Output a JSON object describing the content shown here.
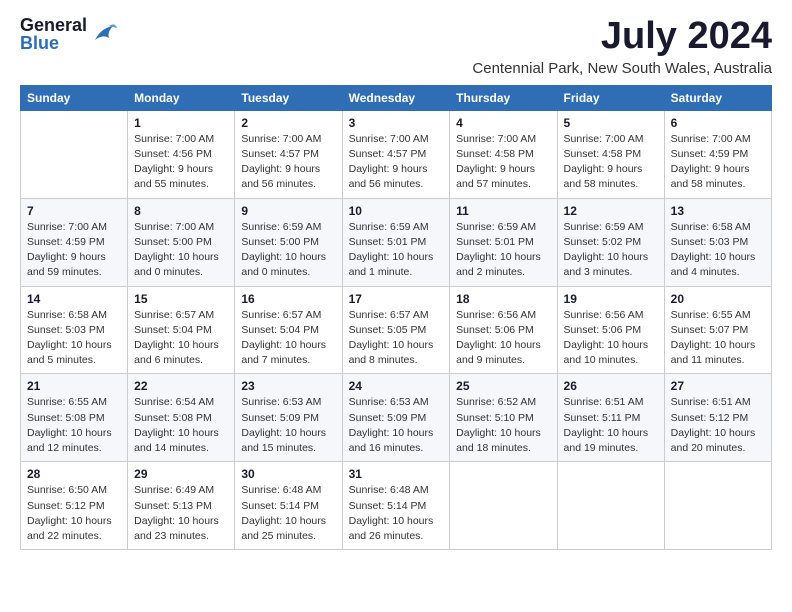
{
  "logo": {
    "general": "General",
    "blue": "Blue"
  },
  "title": "July 2024",
  "subtitle": "Centennial Park, New South Wales, Australia",
  "weekdays": [
    "Sunday",
    "Monday",
    "Tuesday",
    "Wednesday",
    "Thursday",
    "Friday",
    "Saturday"
  ],
  "weeks": [
    [
      {
        "day": "",
        "sunrise": "",
        "sunset": "",
        "daylight": ""
      },
      {
        "day": "1",
        "sunrise": "Sunrise: 7:00 AM",
        "sunset": "Sunset: 4:56 PM",
        "daylight": "Daylight: 9 hours and 55 minutes."
      },
      {
        "day": "2",
        "sunrise": "Sunrise: 7:00 AM",
        "sunset": "Sunset: 4:57 PM",
        "daylight": "Daylight: 9 hours and 56 minutes."
      },
      {
        "day": "3",
        "sunrise": "Sunrise: 7:00 AM",
        "sunset": "Sunset: 4:57 PM",
        "daylight": "Daylight: 9 hours and 56 minutes."
      },
      {
        "day": "4",
        "sunrise": "Sunrise: 7:00 AM",
        "sunset": "Sunset: 4:58 PM",
        "daylight": "Daylight: 9 hours and 57 minutes."
      },
      {
        "day": "5",
        "sunrise": "Sunrise: 7:00 AM",
        "sunset": "Sunset: 4:58 PM",
        "daylight": "Daylight: 9 hours and 58 minutes."
      },
      {
        "day": "6",
        "sunrise": "Sunrise: 7:00 AM",
        "sunset": "Sunset: 4:59 PM",
        "daylight": "Daylight: 9 hours and 58 minutes."
      }
    ],
    [
      {
        "day": "7",
        "sunrise": "Sunrise: 7:00 AM",
        "sunset": "Sunset: 4:59 PM",
        "daylight": "Daylight: 9 hours and 59 minutes."
      },
      {
        "day": "8",
        "sunrise": "Sunrise: 7:00 AM",
        "sunset": "Sunset: 5:00 PM",
        "daylight": "Daylight: 10 hours and 0 minutes."
      },
      {
        "day": "9",
        "sunrise": "Sunrise: 6:59 AM",
        "sunset": "Sunset: 5:00 PM",
        "daylight": "Daylight: 10 hours and 0 minutes."
      },
      {
        "day": "10",
        "sunrise": "Sunrise: 6:59 AM",
        "sunset": "Sunset: 5:01 PM",
        "daylight": "Daylight: 10 hours and 1 minute."
      },
      {
        "day": "11",
        "sunrise": "Sunrise: 6:59 AM",
        "sunset": "Sunset: 5:01 PM",
        "daylight": "Daylight: 10 hours and 2 minutes."
      },
      {
        "day": "12",
        "sunrise": "Sunrise: 6:59 AM",
        "sunset": "Sunset: 5:02 PM",
        "daylight": "Daylight: 10 hours and 3 minutes."
      },
      {
        "day": "13",
        "sunrise": "Sunrise: 6:58 AM",
        "sunset": "Sunset: 5:03 PM",
        "daylight": "Daylight: 10 hours and 4 minutes."
      }
    ],
    [
      {
        "day": "14",
        "sunrise": "Sunrise: 6:58 AM",
        "sunset": "Sunset: 5:03 PM",
        "daylight": "Daylight: 10 hours and 5 minutes."
      },
      {
        "day": "15",
        "sunrise": "Sunrise: 6:57 AM",
        "sunset": "Sunset: 5:04 PM",
        "daylight": "Daylight: 10 hours and 6 minutes."
      },
      {
        "day": "16",
        "sunrise": "Sunrise: 6:57 AM",
        "sunset": "Sunset: 5:04 PM",
        "daylight": "Daylight: 10 hours and 7 minutes."
      },
      {
        "day": "17",
        "sunrise": "Sunrise: 6:57 AM",
        "sunset": "Sunset: 5:05 PM",
        "daylight": "Daylight: 10 hours and 8 minutes."
      },
      {
        "day": "18",
        "sunrise": "Sunrise: 6:56 AM",
        "sunset": "Sunset: 5:06 PM",
        "daylight": "Daylight: 10 hours and 9 minutes."
      },
      {
        "day": "19",
        "sunrise": "Sunrise: 6:56 AM",
        "sunset": "Sunset: 5:06 PM",
        "daylight": "Daylight: 10 hours and 10 minutes."
      },
      {
        "day": "20",
        "sunrise": "Sunrise: 6:55 AM",
        "sunset": "Sunset: 5:07 PM",
        "daylight": "Daylight: 10 hours and 11 minutes."
      }
    ],
    [
      {
        "day": "21",
        "sunrise": "Sunrise: 6:55 AM",
        "sunset": "Sunset: 5:08 PM",
        "daylight": "Daylight: 10 hours and 12 minutes."
      },
      {
        "day": "22",
        "sunrise": "Sunrise: 6:54 AM",
        "sunset": "Sunset: 5:08 PM",
        "daylight": "Daylight: 10 hours and 14 minutes."
      },
      {
        "day": "23",
        "sunrise": "Sunrise: 6:53 AM",
        "sunset": "Sunset: 5:09 PM",
        "daylight": "Daylight: 10 hours and 15 minutes."
      },
      {
        "day": "24",
        "sunrise": "Sunrise: 6:53 AM",
        "sunset": "Sunset: 5:09 PM",
        "daylight": "Daylight: 10 hours and 16 minutes."
      },
      {
        "day": "25",
        "sunrise": "Sunrise: 6:52 AM",
        "sunset": "Sunset: 5:10 PM",
        "daylight": "Daylight: 10 hours and 18 minutes."
      },
      {
        "day": "26",
        "sunrise": "Sunrise: 6:51 AM",
        "sunset": "Sunset: 5:11 PM",
        "daylight": "Daylight: 10 hours and 19 minutes."
      },
      {
        "day": "27",
        "sunrise": "Sunrise: 6:51 AM",
        "sunset": "Sunset: 5:12 PM",
        "daylight": "Daylight: 10 hours and 20 minutes."
      }
    ],
    [
      {
        "day": "28",
        "sunrise": "Sunrise: 6:50 AM",
        "sunset": "Sunset: 5:12 PM",
        "daylight": "Daylight: 10 hours and 22 minutes."
      },
      {
        "day": "29",
        "sunrise": "Sunrise: 6:49 AM",
        "sunset": "Sunset: 5:13 PM",
        "daylight": "Daylight: 10 hours and 23 minutes."
      },
      {
        "day": "30",
        "sunrise": "Sunrise: 6:48 AM",
        "sunset": "Sunset: 5:14 PM",
        "daylight": "Daylight: 10 hours and 25 minutes."
      },
      {
        "day": "31",
        "sunrise": "Sunrise: 6:48 AM",
        "sunset": "Sunset: 5:14 PM",
        "daylight": "Daylight: 10 hours and 26 minutes."
      },
      {
        "day": "",
        "sunrise": "",
        "sunset": "",
        "daylight": ""
      },
      {
        "day": "",
        "sunrise": "",
        "sunset": "",
        "daylight": ""
      },
      {
        "day": "",
        "sunrise": "",
        "sunset": "",
        "daylight": ""
      }
    ]
  ]
}
